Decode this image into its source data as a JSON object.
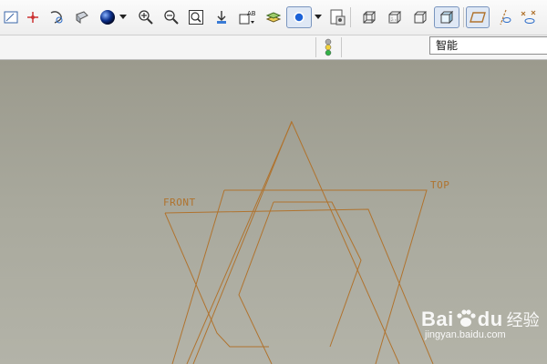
{
  "toolbar": {
    "icons": [
      "plane-sketch-icon",
      "axis-icon",
      "datum-display-icon",
      "orient-icon",
      "shading-sphere-icon",
      "dropdown-arrow-icon",
      "zoom-in-icon",
      "zoom-out-icon",
      "refit-icon",
      "spin-center-icon",
      "annotation-icon",
      "layers-icon",
      "datum-point-icon",
      "dropdown-arrow-icon",
      "model-tree-icon",
      "wireframe-icon",
      "hidden-line-icon",
      "no-hidden-icon",
      "shaded-icon",
      "datum-plane-display-icon",
      "datum-axis-display-icon",
      "point-display-icon"
    ]
  },
  "filter": {
    "value": "智能"
  },
  "viewport": {
    "labels": {
      "front": "FRONT",
      "top": "TOP"
    }
  },
  "watermark": {
    "brand": "Bai",
    "brand2": "du",
    "cn": "经验",
    "url": "jingyan.baidu.com"
  },
  "colors": {
    "datum": "#b0732e",
    "background": "#a6a597"
  }
}
